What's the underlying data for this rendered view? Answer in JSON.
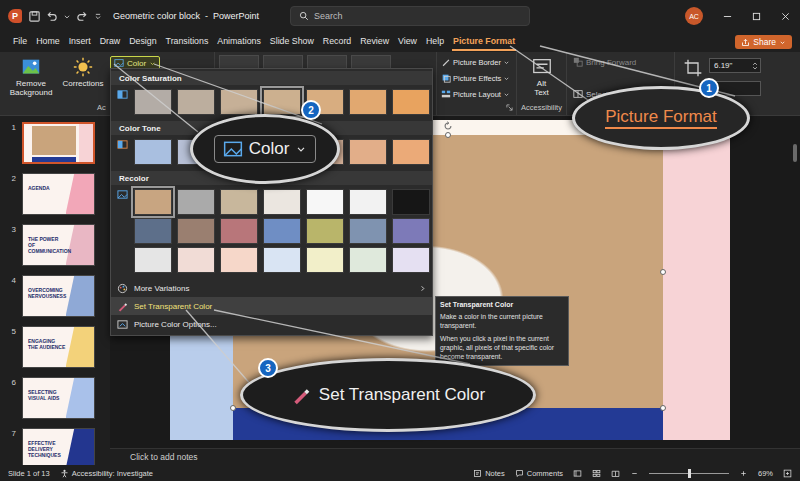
{
  "window": {
    "app_logo_text": "P",
    "title": "Geometric color block  -  PowerPoint",
    "search_placeholder": "Search",
    "avatar": "AC"
  },
  "menu_tabs": [
    {
      "label": "File",
      "selected": false
    },
    {
      "label": "Home",
      "selected": false
    },
    {
      "label": "Insert",
      "selected": false
    },
    {
      "label": "Draw",
      "selected": false
    },
    {
      "label": "Design",
      "selected": false
    },
    {
      "label": "Transitions",
      "selected": false
    },
    {
      "label": "Animations",
      "selected": false
    },
    {
      "label": "Slide Show",
      "selected": false
    },
    {
      "label": "Record",
      "selected": false
    },
    {
      "label": "Review",
      "selected": false
    },
    {
      "label": "View",
      "selected": false
    },
    {
      "label": "Help",
      "selected": false
    },
    {
      "label": "Picture Format",
      "selected": true
    }
  ],
  "share_button": {
    "label": "Share"
  },
  "ribbon": {
    "adjust": {
      "remove_background": "Remove Background",
      "corrections": "Corrections",
      "color": {
        "label": "Color",
        "open": true
      },
      "group_label": "Ac"
    },
    "picture_styles": [
      "Picture Border",
      "Picture Effects",
      "Picture Layout"
    ],
    "accessibility": {
      "alt_text": "Alt Text",
      "group_label": "Accessibility"
    },
    "arrange": {
      "bring_forward": {
        "label": "Bring Forward",
        "disabled": true
      },
      "selection": "Selection"
    },
    "size": {
      "height": "6.19\""
    }
  },
  "slides": [
    {
      "number": "1",
      "kind": "photo",
      "title": "",
      "color": "#f7d3d6",
      "selected": true
    },
    {
      "number": "2",
      "kind": "title",
      "title": "AGENDA",
      "color": "#f2a7b8",
      "selected": false
    },
    {
      "number": "3",
      "kind": "title",
      "title": "THE POWER OF COMMUNICATION",
      "color": "#e9b7c4",
      "selected": false
    },
    {
      "number": "4",
      "kind": "title",
      "title": "OVERCOMING NERVOUSNESS",
      "color": "#8fa9d6",
      "selected": false
    },
    {
      "number": "5",
      "kind": "title",
      "title": "ENGAGING THE AUDIENCE",
      "color": "#f3d27a",
      "selected": false
    },
    {
      "number": "6",
      "kind": "title",
      "title": "SELECTING VISUAL AIDS",
      "color": "#a9c1ea",
      "selected": false
    },
    {
      "number": "7",
      "kind": "title",
      "title": "EFFECTIVE DELIVERY TECHNIQUES",
      "color": "#23368f",
      "selected": false
    }
  ],
  "slide": {
    "notes_placeholder": "Click to add notes"
  },
  "color_menu": {
    "sections": [
      {
        "title": "Color Saturation",
        "swatches": [
          {
            "color": "#b3aca6",
            "selected": false
          },
          {
            "color": "#bcae9e",
            "selected": false
          },
          {
            "color": "#c6b097",
            "selected": false
          },
          {
            "color": "#ccb08f",
            "selected": true
          },
          {
            "color": "#d8ad80",
            "selected": false
          },
          {
            "color": "#e1a870",
            "selected": false
          },
          {
            "color": "#e8a35f",
            "selected": false
          }
        ]
      },
      {
        "title": "Color Tone",
        "swatches": [
          {
            "color": "#a9bfe0",
            "selected": false
          },
          {
            "color": "#b7c0d6",
            "selected": false
          },
          {
            "color": "#c4bfc8",
            "selected": false
          },
          {
            "color": "#cfb9ab",
            "selected": true
          },
          {
            "color": "#d9b49b",
            "selected": false
          },
          {
            "color": "#e2ae89",
            "selected": false
          },
          {
            "color": "#ebaa78",
            "selected": false
          }
        ]
      },
      {
        "title": "Recolor",
        "swatches": [
          {
            "color": "#c8a581",
            "selected": true
          },
          {
            "color": "#aaaaaa",
            "selected": false
          },
          {
            "color": "#c8b79c",
            "selected": false
          },
          {
            "color": "#ebe6e0",
            "selected": false
          },
          {
            "color": "#f7f7f7",
            "selected": false
          },
          {
            "color": "#f2f2f2",
            "selected": false
          },
          {
            "color": "#161616",
            "selected": false
          },
          {
            "color": "#5d6f8a",
            "selected": false
          },
          {
            "color": "#9a7f70",
            "selected": false
          },
          {
            "color": "#b8767a",
            "selected": false
          },
          {
            "color": "#6f8ec4",
            "selected": false
          },
          {
            "color": "#b9b56a",
            "selected": false
          },
          {
            "color": "#7f93b0",
            "selected": false
          },
          {
            "color": "#7d7ab8",
            "selected": false
          },
          {
            "color": "#e5e5e5",
            "selected": false
          },
          {
            "color": "#f1dcd6",
            "selected": false
          },
          {
            "color": "#f6d7c9",
            "selected": false
          },
          {
            "color": "#d9e4f3",
            "selected": false
          },
          {
            "color": "#f2efc9",
            "selected": false
          },
          {
            "color": "#dfe9dc",
            "selected": false
          },
          {
            "color": "#e5e0f2",
            "selected": false
          }
        ]
      }
    ],
    "items": [
      {
        "label": "More Variations",
        "has_submenu": true,
        "selected": false
      },
      {
        "label": "Set Transparent Color",
        "has_submenu": false,
        "selected": true
      },
      {
        "label": "Picture Color Options...",
        "has_submenu": false,
        "selected": false
      }
    ]
  },
  "tooltip": {
    "title": "Set Transparent Color",
    "lines": [
      "Make a color in the current picture transparent.",
      "When you click a pixel in the current graphic, all pixels of that specific color become transparent."
    ]
  },
  "callouts": [
    {
      "number": "1",
      "label": "Picture Format"
    },
    {
      "number": "2",
      "label": "Color"
    },
    {
      "number": "3",
      "label": "Set Transparent Color"
    }
  ],
  "status_bar": {
    "slide_info": "Slide 1 of 13",
    "accessibility": "Accessibility: Investigate",
    "notes": "Notes",
    "comments": "Comments",
    "zoom": {
      "reading": "69%",
      "level": 0.5
    }
  }
}
